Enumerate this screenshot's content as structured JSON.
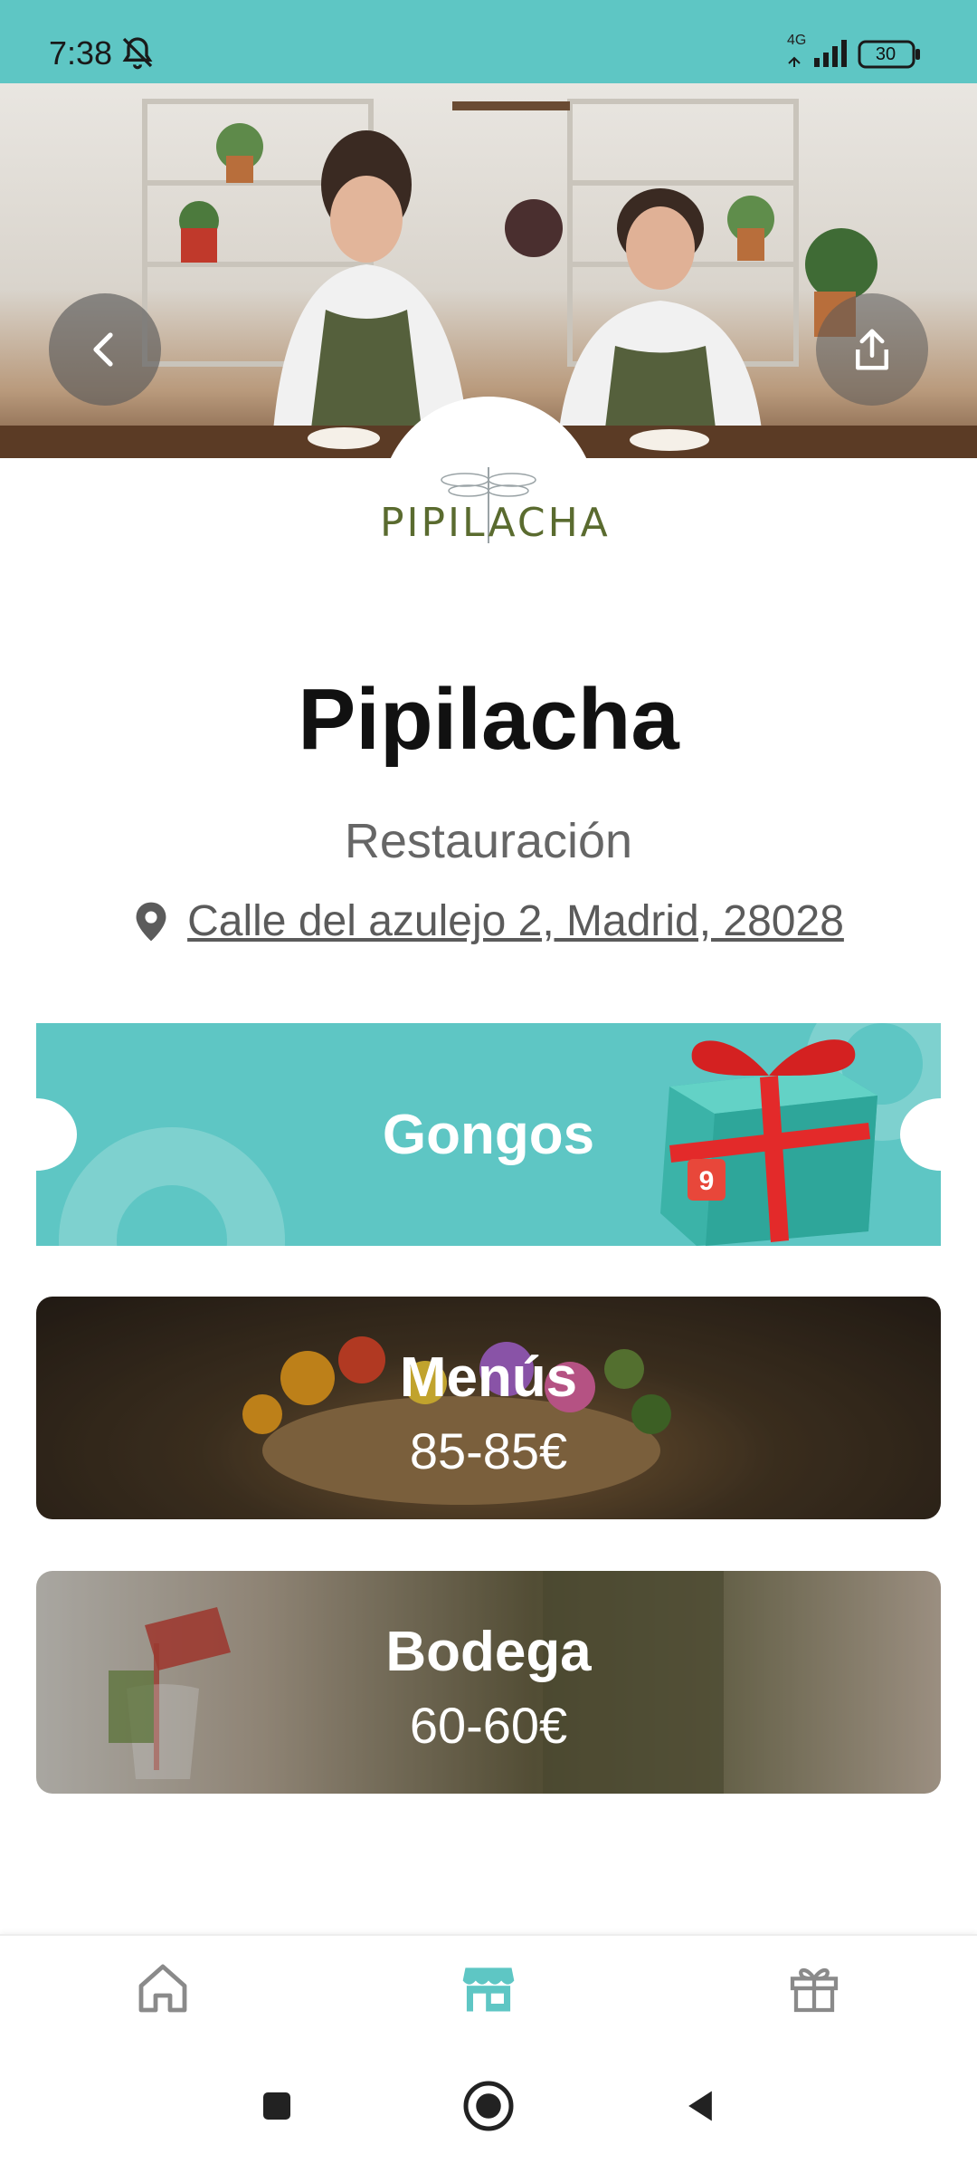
{
  "status_bar": {
    "time": "7:38",
    "network": "4G",
    "battery": "30",
    "icons": [
      "bell-off-icon",
      "signal-icon",
      "battery-icon"
    ]
  },
  "hero": {
    "back_icon": "chevron-left-icon",
    "share_icon": "share-icon"
  },
  "business": {
    "logo_text": "PIPILACHA",
    "name": "Pipilacha",
    "category": "Restauración",
    "address": "Calle del azulejo 2, Madrid, 28028",
    "address_icon": "location-pin-icon"
  },
  "gongos": {
    "label": "Gongos",
    "badge": "9"
  },
  "cards": [
    {
      "title": "Menús",
      "price": "85-85€"
    },
    {
      "title": "Bodega",
      "price": "60-60€"
    }
  ],
  "bottom_nav": {
    "items": [
      {
        "icon": "home-icon",
        "active": false
      },
      {
        "icon": "store-icon",
        "active": true
      },
      {
        "icon": "gift-icon",
        "active": false
      }
    ],
    "active_color": "#5ec6c4",
    "inactive_color": "#8a8a8a"
  },
  "system_nav": [
    "recents-icon",
    "home-circle-icon",
    "back-triangle-icon"
  ],
  "colors": {
    "accent": "#5ec6c4",
    "gift_red": "#e32a2a"
  }
}
